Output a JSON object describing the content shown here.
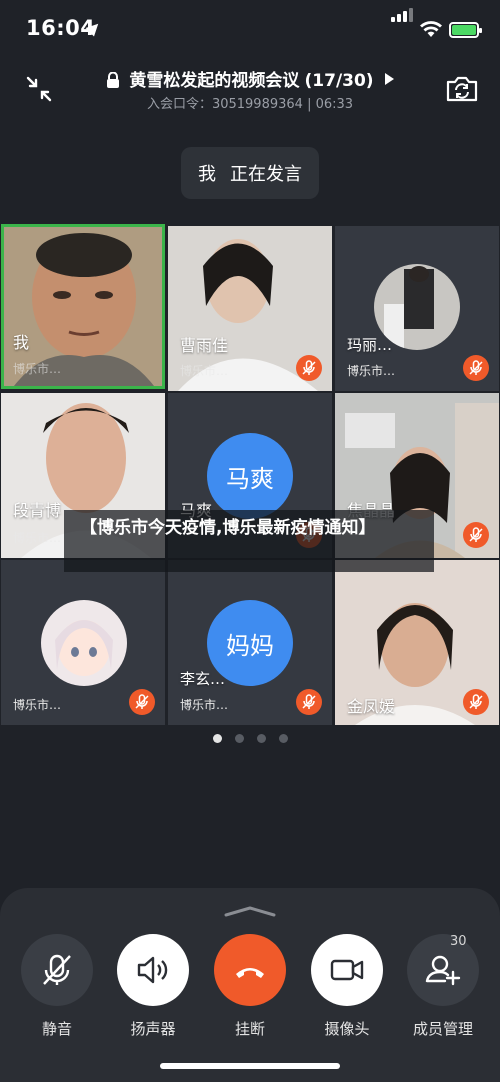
{
  "status_bar": {
    "time": "16:04"
  },
  "header": {
    "title": "黄雪松发起的视频会议",
    "count": "(17/30)",
    "subtitle": "入会口令：30519989364 | 06:33"
  },
  "speaking": {
    "who": "我",
    "status": "正在发言"
  },
  "participants": [
    {
      "name": "我",
      "location": "博乐市…"
    },
    {
      "name": "曹雨佳",
      "location": "博乐市…"
    },
    {
      "name": "玛丽…",
      "location": "博乐市…"
    },
    {
      "name": "段青博",
      "location": "博乐市…"
    },
    {
      "name": "马爽",
      "avatar_text": "马爽",
      "location": ""
    },
    {
      "name": "焦晶晶",
      "location": ""
    },
    {
      "name": "",
      "location": "博乐市…"
    },
    {
      "name": "李玄…",
      "avatar_text": "妈妈",
      "location": "博乐市…"
    },
    {
      "name": "金凤媛",
      "location": ""
    }
  ],
  "overlay_banner": "【博乐市今天疫情,博乐最新疫情通知】",
  "toolbar": {
    "mute": "静音",
    "speaker": "扬声器",
    "hangup": "挂断",
    "camera": "摄像头",
    "members": "成员管理",
    "member_count": "30"
  },
  "colors": {
    "accent_blue": "#3f8cf0",
    "hangup_orange": "#f05a2a",
    "mute_badge": "#f05a2a"
  }
}
